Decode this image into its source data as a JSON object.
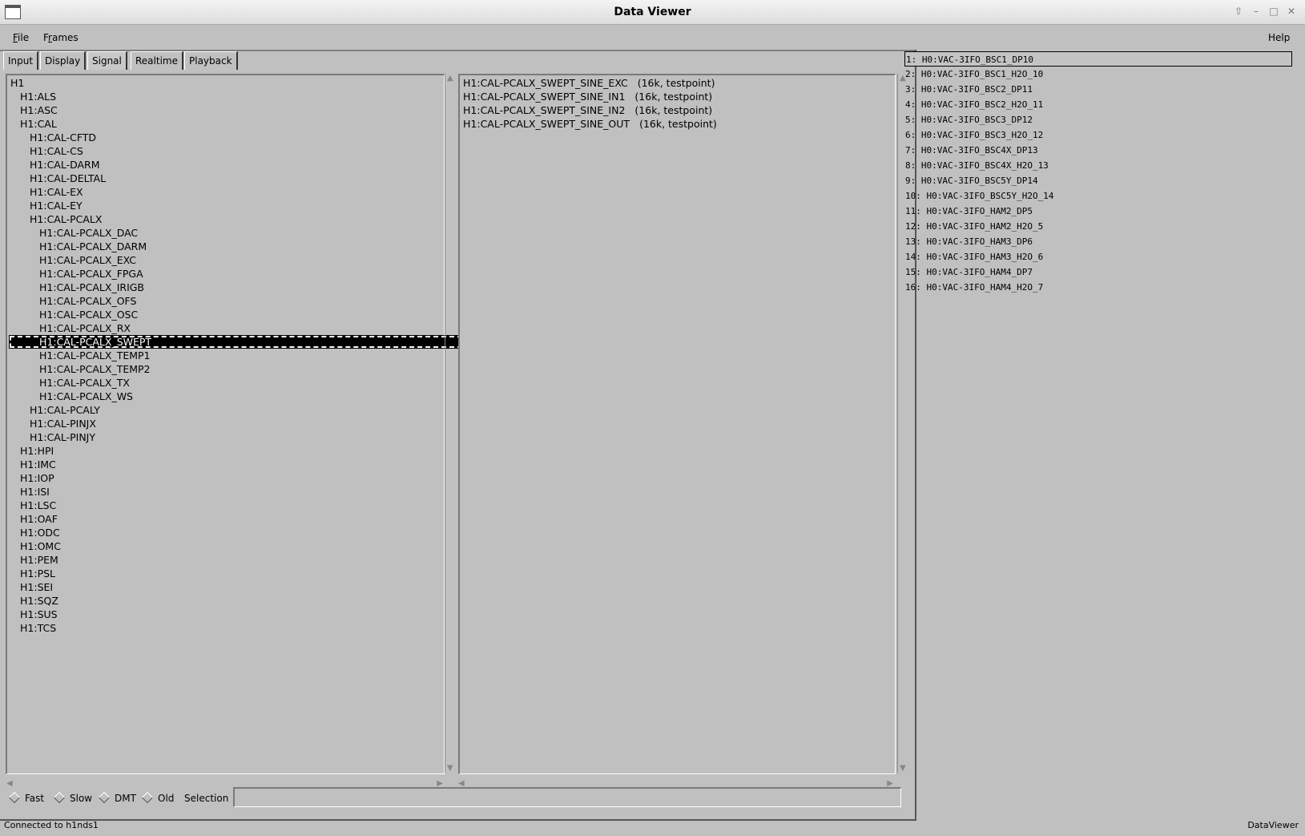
{
  "window": {
    "title": "Data Viewer"
  },
  "menu": {
    "file": "File",
    "frames": "Frames",
    "help": "Help"
  },
  "tabs": [
    "Input",
    "Display",
    "Signal",
    "Realtime",
    "Playback"
  ],
  "active_tab": "Signal",
  "tree": [
    {
      "label": "H1",
      "level": 0
    },
    {
      "label": "H1:ALS",
      "level": 1
    },
    {
      "label": "H1:ASC",
      "level": 1
    },
    {
      "label": "H1:CAL",
      "level": 1
    },
    {
      "label": "H1:CAL-CFTD",
      "level": 2
    },
    {
      "label": "H1:CAL-CS",
      "level": 2
    },
    {
      "label": "H1:CAL-DARM",
      "level": 2
    },
    {
      "label": "H1:CAL-DELTAL",
      "level": 2
    },
    {
      "label": "H1:CAL-EX",
      "level": 2
    },
    {
      "label": "H1:CAL-EY",
      "level": 2
    },
    {
      "label": "H1:CAL-PCALX",
      "level": 2
    },
    {
      "label": "H1:CAL-PCALX_DAC",
      "level": 3
    },
    {
      "label": "H1:CAL-PCALX_DARM",
      "level": 3
    },
    {
      "label": "H1:CAL-PCALX_EXC",
      "level": 3
    },
    {
      "label": "H1:CAL-PCALX_FPGA",
      "level": 3
    },
    {
      "label": "H1:CAL-PCALX_IRIGB",
      "level": 3
    },
    {
      "label": "H1:CAL-PCALX_OFS",
      "level": 3
    },
    {
      "label": "H1:CAL-PCALX_OSC",
      "level": 3
    },
    {
      "label": "H1:CAL-PCALX_RX",
      "level": 3
    },
    {
      "label": "H1:CAL-PCALX_SWEPT",
      "level": 3,
      "selected": true
    },
    {
      "label": "H1:CAL-PCALX_TEMP1",
      "level": 3
    },
    {
      "label": "H1:CAL-PCALX_TEMP2",
      "level": 3
    },
    {
      "label": "H1:CAL-PCALX_TX",
      "level": 3
    },
    {
      "label": "H1:CAL-PCALX_WS",
      "level": 3
    },
    {
      "label": "H1:CAL-PCALY",
      "level": 2
    },
    {
      "label": "H1:CAL-PINJX",
      "level": 2
    },
    {
      "label": "H1:CAL-PINJY",
      "level": 2
    },
    {
      "label": "H1:HPI",
      "level": 1
    },
    {
      "label": "H1:IMC",
      "level": 1
    },
    {
      "label": "H1:IOP",
      "level": 1
    },
    {
      "label": "H1:ISI",
      "level": 1
    },
    {
      "label": "H1:LSC",
      "level": 1
    },
    {
      "label": "H1:OAF",
      "level": 1
    },
    {
      "label": "H1:ODC",
      "level": 1
    },
    {
      "label": "H1:OMC",
      "level": 1
    },
    {
      "label": "H1:PEM",
      "level": 1
    },
    {
      "label": "H1:PSL",
      "level": 1
    },
    {
      "label": "H1:SEI",
      "level": 1
    },
    {
      "label": "H1:SQZ",
      "level": 1
    },
    {
      "label": "H1:SUS",
      "level": 1
    },
    {
      "label": "H1:TCS",
      "level": 1
    }
  ],
  "channels": [
    {
      "name": "H1:CAL-PCALX_SWEPT_SINE_EXC",
      "info": "(16k, testpoint)"
    },
    {
      "name": "H1:CAL-PCALX_SWEPT_SINE_IN1",
      "info": "(16k, testpoint)"
    },
    {
      "name": "H1:CAL-PCALX_SWEPT_SINE_IN2",
      "info": "(16k, testpoint)"
    },
    {
      "name": "H1:CAL-PCALX_SWEPT_SINE_OUT",
      "info": "(16k, testpoint)"
    }
  ],
  "channel_list": [
    "1: H0:VAC-3IFO_BSC1_DP10",
    "2: H0:VAC-3IFO_BSC1_H2O_10",
    "3: H0:VAC-3IFO_BSC2_DP11",
    "4: H0:VAC-3IFO_BSC2_H2O_11",
    "5: H0:VAC-3IFO_BSC3_DP12",
    "6: H0:VAC-3IFO_BSC3_H2O_12",
    "7: H0:VAC-3IFO_BSC4X_DP13",
    "8: H0:VAC-3IFO_BSC4X_H2O_13",
    "9: H0:VAC-3IFO_BSC5Y_DP14",
    "10: H0:VAC-3IFO_BSC5Y_H2O_14",
    "11: H0:VAC-3IFO_HAM2_DP5",
    "12: H0:VAC-3IFO_HAM2_H2O_5",
    "13: H0:VAC-3IFO_HAM3_DP6",
    "14: H0:VAC-3IFO_HAM3_H2O_6",
    "15: H0:VAC-3IFO_HAM4_DP7",
    "16: H0:VAC-3IFO_HAM4_H2O_7"
  ],
  "bottom": {
    "radios": [
      "Fast",
      "Slow",
      "DMT",
      "Old"
    ],
    "selection_label": "Selection",
    "selection_value": ""
  },
  "status": {
    "left": "Connected to h1nds1",
    "right": "DataViewer"
  }
}
